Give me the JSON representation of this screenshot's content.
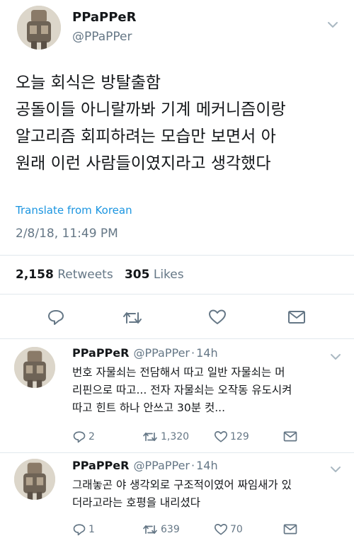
{
  "main_tweet": {
    "display_name": "PPaPPeR",
    "handle": "@PPaPPer",
    "text_lines": [
      "오늘 회식은 방탈출함",
      "공돌이들 아니랄까봐 기계 메커니즘이랑",
      "알고리즘 회피하려는 모습만 보면서 아",
      "원래 이런 사람들이였지라고 생각했다"
    ],
    "translate_label": "Translate from Korean",
    "timestamp": "2/8/18, 11:49 PM",
    "retweets_count": "2,158",
    "retweets_label": "Retweets",
    "likes_count": "305",
    "likes_label": "Likes",
    "actions": [
      "reply-icon",
      "retweet-icon",
      "like-icon",
      "message-icon"
    ]
  },
  "replies": [
    {
      "display_name": "PPaPPeR",
      "handle": "@PPaPPer",
      "time": "14h",
      "text_lines": [
        "번호 자물쇠는 전담해서 따고 일반 자물쇠는 머",
        "리핀으로 따고... 전자 자물쇠는 오작동 유도시켜",
        "따고 힌트 하나 안쓰고 30분 컷..."
      ],
      "reply_count": "2",
      "retweet_count": "1,320",
      "like_count": "129"
    },
    {
      "display_name": "PPaPPeR",
      "handle": "@PPaPPer",
      "time": "14h",
      "text_lines": [
        "그래놓곤 야 생각외로 구조적이였어 짜임새가 있",
        "더라고라는 호평을 내리셨다"
      ],
      "reply_count": "1",
      "retweet_count": "639",
      "like_count": "70"
    }
  ],
  "colors": {
    "text": "#14171a",
    "secondary": "#657786",
    "link": "#1b95e0",
    "divider": "#e1e8ed"
  }
}
